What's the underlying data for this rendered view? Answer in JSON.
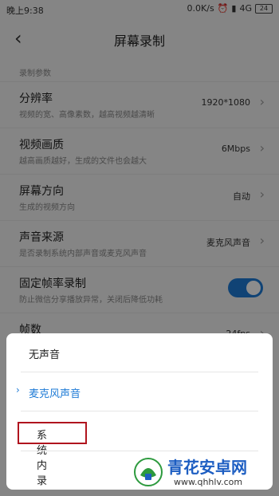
{
  "status": {
    "time": "晚上9:38",
    "speed": "0.0K/s",
    "network": "4G",
    "battery": "24"
  },
  "header": {
    "title": "屏幕录制"
  },
  "section_label": "录制参数",
  "rows": [
    {
      "name": "分辨率",
      "desc": "视频的宽、高像素数，越高视频越清晰",
      "value": "1920*1080"
    },
    {
      "name": "视频画质",
      "desc": "越高画质越好，生成的文件也会越大",
      "value": "6Mbps"
    },
    {
      "name": "屏幕方向",
      "desc": "生成的视频方向",
      "value": "自动"
    },
    {
      "name": "声音来源",
      "desc": "是否录制系统内部声音或麦克风声音",
      "value": "麦克风声音"
    },
    {
      "name": "固定帧率录制",
      "desc": "防止微信分享播放异常，关闭后降低功耗"
    },
    {
      "name": "帧数",
      "value": "24fps"
    }
  ],
  "sheet": {
    "options": [
      "无声音",
      "麦克风声音",
      "系统内录"
    ],
    "selected_index": 1
  },
  "watermark": {
    "name": "青花安卓网",
    "url": "www.qhhlv.com"
  },
  "colors": {
    "accent": "#1e7bd6",
    "highlight": "#b0141e",
    "watermark": "#1d5ec2"
  }
}
